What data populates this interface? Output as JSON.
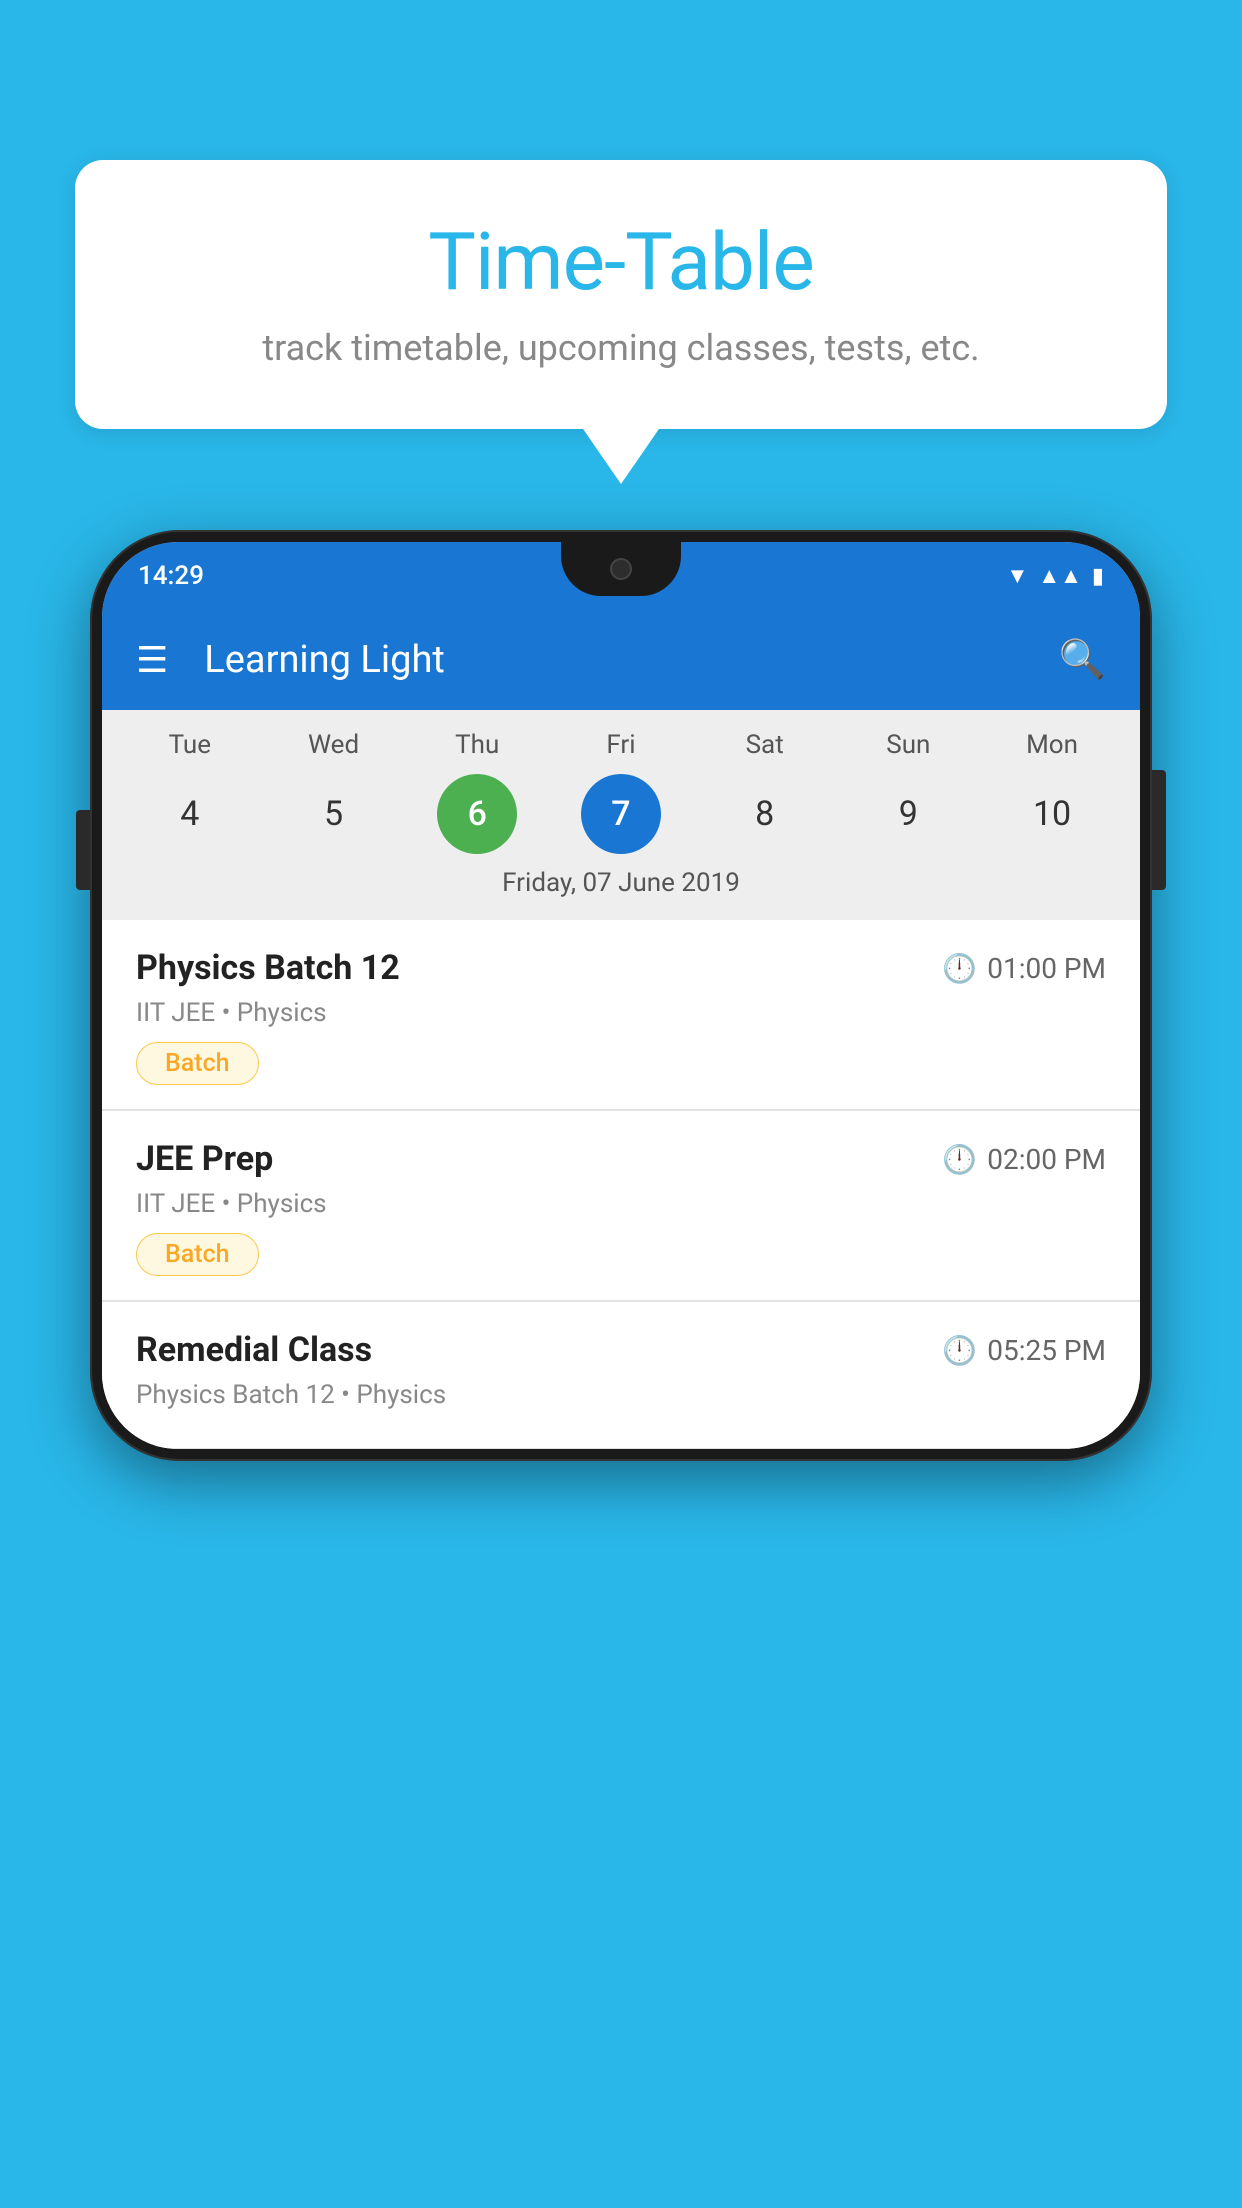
{
  "background_color": "#29b6e8",
  "bubble": {
    "title": "Time-Table",
    "subtitle": "track timetable, upcoming classes, tests, etc."
  },
  "phone": {
    "status_bar": {
      "time": "14:29",
      "icons": [
        "wifi",
        "signal",
        "battery"
      ]
    },
    "app_bar": {
      "title": "Learning Light",
      "menu_icon": "☰",
      "search_icon": "🔍"
    },
    "calendar": {
      "days": [
        {
          "label": "Tue",
          "num": "4"
        },
        {
          "label": "Wed",
          "num": "5"
        },
        {
          "label": "Thu",
          "num": "6",
          "state": "today"
        },
        {
          "label": "Fri",
          "num": "7",
          "state": "selected"
        },
        {
          "label": "Sat",
          "num": "8"
        },
        {
          "label": "Sun",
          "num": "9"
        },
        {
          "label": "Mon",
          "num": "10"
        }
      ],
      "selected_date": "Friday, 07 June 2019"
    },
    "schedule": [
      {
        "title": "Physics Batch 12",
        "time": "01:00 PM",
        "subtitle": "IIT JEE • Physics",
        "badge": "Batch"
      },
      {
        "title": "JEE Prep",
        "time": "02:00 PM",
        "subtitle": "IIT JEE • Physics",
        "badge": "Batch"
      },
      {
        "title": "Remedial Class",
        "time": "05:25 PM",
        "subtitle": "Physics Batch 12 • Physics",
        "badge": null
      }
    ]
  }
}
